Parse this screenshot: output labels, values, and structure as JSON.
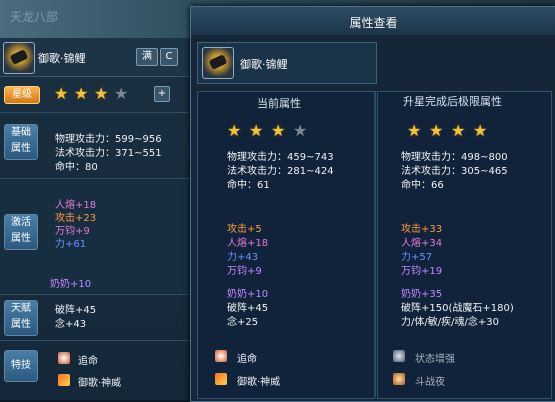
{
  "background": {
    "watermark": "天龙八部"
  },
  "left": {
    "name": "御歌·锦鲤",
    "btn_full": "满",
    "btn_refresh": "C",
    "star_label": "星级",
    "plus": "+",
    "basic_label": [
      "基础",
      "属性"
    ],
    "basic_stats": [
      "物理攻击力：599~956",
      "法术攻击力：371~551",
      "命中：80"
    ],
    "activate_label": [
      "激活",
      "属性"
    ],
    "activate_stats": [
      "人熔+18",
      "攻击+23",
      "万钧+9",
      "力+61"
    ],
    "activate_extra": "奶奶+10",
    "talent_label": [
      "天赋",
      "属性"
    ],
    "talent_stats": [
      "破阵+45",
      "念+43"
    ],
    "skill_label": "特技",
    "skills": [
      "追命",
      "御歌·神威"
    ]
  },
  "window": {
    "title": "属性查看",
    "name": "御歌·锦鲤",
    "current": {
      "header": "当前属性",
      "stats": [
        "物理攻击力：459~743",
        "法术攻击力：281~424",
        "命中：61"
      ],
      "extra": [
        {
          "t": "攻击+5",
          "c": "orange"
        },
        {
          "t": "人熔+18",
          "c": "pink"
        },
        {
          "t": "力+43",
          "c": "blue"
        },
        {
          "t": "万钧+9",
          "c": "purple"
        }
      ],
      "extra2": [
        {
          "t": "奶奶+10",
          "c": "purple"
        },
        {
          "t": "破阵+45",
          "c": "white"
        },
        {
          "t": "念+25",
          "c": "white"
        }
      ],
      "skills": [
        "追命",
        "御歌·神威"
      ]
    },
    "upgrade": {
      "header": "升星完成后极限属性",
      "stats": [
        "物理攻击力：498~800",
        "法术攻击力：305~465",
        "命中：66"
      ],
      "extra": [
        {
          "t": "攻击+33",
          "c": "orange"
        },
        {
          "t": "人熔+34",
          "c": "pink"
        },
        {
          "t": "力+57",
          "c": "blue"
        },
        {
          "t": "万钧+19",
          "c": "purple"
        }
      ],
      "extra2": [
        {
          "t": "奶奶+35",
          "c": "purple"
        },
        {
          "t": "破阵+150(战魔石+180)",
          "c": "white"
        },
        {
          "t": "力/体/敏/疾/魂/念+30",
          "c": "white"
        }
      ],
      "skills": [
        "状态增强",
        "斗战夜"
      ]
    }
  },
  "stars": {
    "left": [
      1,
      1,
      1,
      0
    ],
    "current": [
      1,
      1,
      1,
      0
    ],
    "upgrade": [
      1,
      1,
      1,
      1
    ]
  },
  "colors": {
    "star_on": "#f4c23a",
    "star_off": "#7d8793",
    "pink": "#e47ad8",
    "orange": "#ff9a3c",
    "blue": "#6a8fff",
    "purple": "#c389ff"
  }
}
